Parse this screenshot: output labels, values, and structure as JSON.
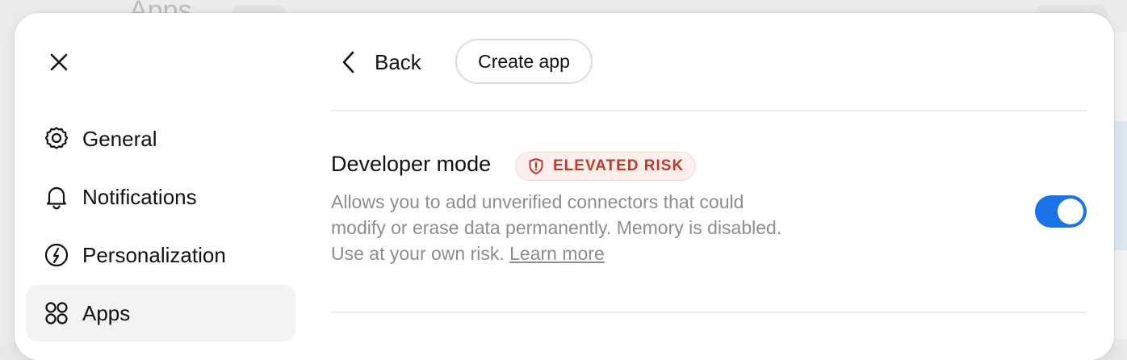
{
  "backdrop": {
    "title_fragment": "Apps"
  },
  "sidebar": {
    "close_icon": "close-icon",
    "items": [
      {
        "label": "General",
        "icon": "gear-icon",
        "active": false
      },
      {
        "label": "Notifications",
        "icon": "bell-icon",
        "active": false
      },
      {
        "label": "Personalization",
        "icon": "personalization-icon",
        "active": false
      },
      {
        "label": "Apps",
        "icon": "apps-grid-icon",
        "active": true
      }
    ]
  },
  "header": {
    "back_label": "Back",
    "create_app_label": "Create app"
  },
  "setting": {
    "title": "Developer mode",
    "badge": "ELEVATED RISK",
    "description": "Allows you to add unverified connectors that could modify or erase data permanently. Memory is disabled. Use at your own risk.",
    "learn_more": "Learn more",
    "toggle_on": true
  },
  "colors": {
    "accent": "#1a73e8",
    "risk": "#c0392b",
    "risk_bg": "#fdf0ec",
    "active_nav_bg": "#f3f3f3"
  }
}
